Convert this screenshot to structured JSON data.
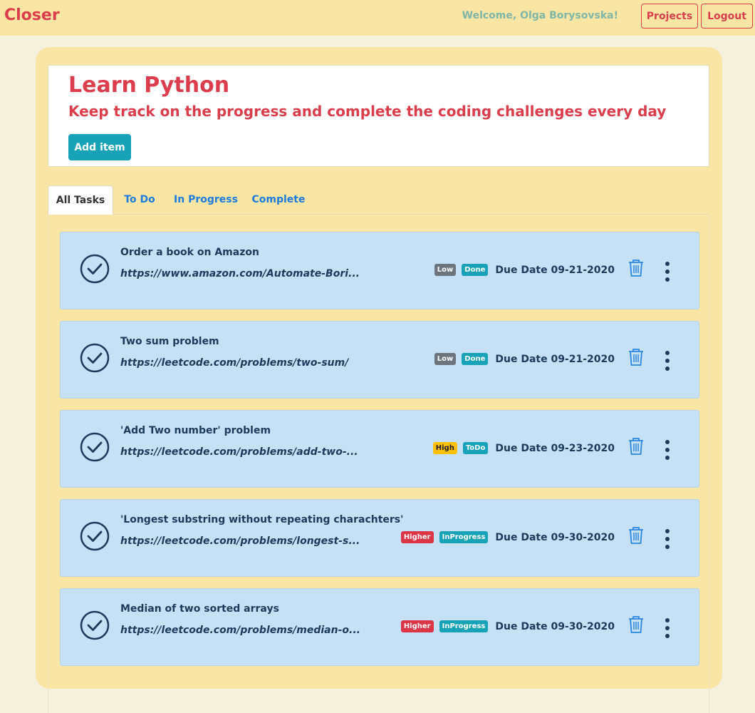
{
  "navbar": {
    "brand": "Closer",
    "welcome": "Welcome, Olga Borysovska!",
    "projects_label": "Projects",
    "logout_label": "Logout"
  },
  "project": {
    "title": "Learn Python",
    "subtitle": "Keep track on the progress and complete the coding challenges every day",
    "add_item_label": "Add item"
  },
  "tabs": [
    {
      "label": "All Tasks",
      "active": true
    },
    {
      "label": "To Do",
      "active": false
    },
    {
      "label": "In Progress",
      "active": false
    },
    {
      "label": "Complete",
      "active": false
    }
  ],
  "colors": {
    "brand_red": "#dc3d4c",
    "card_blue": "#c6e0f6",
    "text_navy": "#1b3a5c",
    "icon_blue": "#2b86e0",
    "teal": "#17a2b8",
    "priority_low": "#6c757d",
    "priority_high": "#ffc107",
    "priority_higher": "#dc3545"
  },
  "icons": {
    "check": "check-circle-icon",
    "delete": "trash-icon",
    "menu": "kebab-menu-icon"
  },
  "tasks": [
    {
      "title": "Order a book on Amazon",
      "link": "https://www.amazon.com/Automate-Bori...",
      "priority": "Low",
      "status": "Done",
      "due": "Due Date 09-21-2020"
    },
    {
      "title": "Two sum problem",
      "link": "https://leetcode.com/problems/two-sum/",
      "priority": "Low",
      "status": "Done",
      "due": "Due Date 09-21-2020"
    },
    {
      "title": "'Add Two number' problem",
      "link": "https://leetcode.com/problems/add-two-...",
      "priority": "High",
      "status": "ToDo",
      "due": "Due Date 09-23-2020"
    },
    {
      "title": "'Longest substring without repeating charachters'",
      "link": "https://leetcode.com/problems/longest-s...",
      "priority": "Higher",
      "status": "InProgress",
      "due": "Due Date 09-30-2020"
    },
    {
      "title": "Median of two sorted arrays",
      "link": "https://leetcode.com/problems/median-o...",
      "priority": "Higher",
      "status": "InProgress",
      "due": "Due Date 09-30-2020"
    }
  ]
}
